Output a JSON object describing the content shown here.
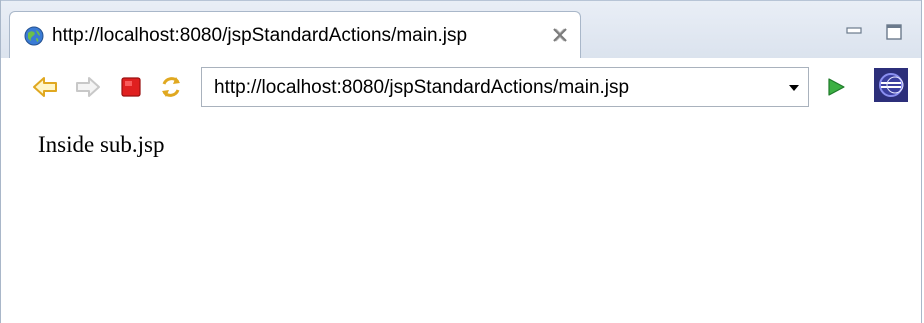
{
  "tab": {
    "title": "http://localhost:8080/jspStandardActions/main.jsp",
    "icon": "globe-icon"
  },
  "window_controls": {
    "minimize_icon": "minimize-icon",
    "maximize_icon": "maximize-icon"
  },
  "toolbar": {
    "back_icon": "back-arrow-icon",
    "forward_icon": "forward-arrow-icon",
    "stop_icon": "stop-icon",
    "refresh_icon": "refresh-icon",
    "go_icon": "go-icon",
    "eclipse_icon": "eclipse-icon"
  },
  "address_bar": {
    "url": "http://localhost:8080/jspStandardActions/main.jsp"
  },
  "page": {
    "body_text": "Inside sub.jsp"
  },
  "colors": {
    "back_forward": "#f0c040",
    "stop": "#e02020",
    "go": "#3cb043",
    "eclipse": "#2c2f7a"
  }
}
